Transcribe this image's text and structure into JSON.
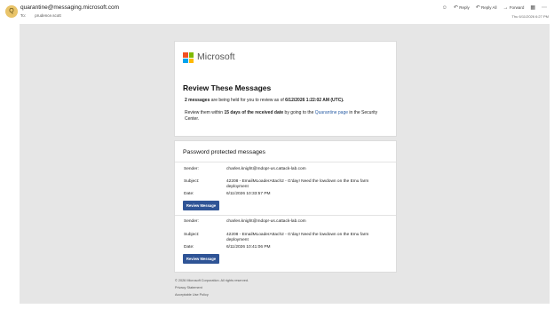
{
  "header": {
    "avatar_initial": "Q",
    "from": "quarantine@messaging.microsoft.com",
    "to_label": "To:",
    "to": "prudence.scott",
    "actions": [
      {
        "icon": "smiley-icon",
        "label": ""
      },
      {
        "icon": "reply-icon",
        "label": "Reply"
      },
      {
        "icon": "reply-all-icon",
        "label": "Reply All"
      },
      {
        "icon": "forward-icon",
        "label": "Forward"
      },
      {
        "icon": "apps-icon",
        "label": ""
      },
      {
        "icon": "more-icon",
        "label": ""
      }
    ],
    "date": "Thu 6/11/2026 6:27 PM"
  },
  "card1": {
    "brand": "Microsoft",
    "title": "Review These Messages",
    "p1_count": "2 messages",
    "p1_mid": " are being held for you to review as of ",
    "p1_date": "6/12/2026 1:22:02 AM (UTC).",
    "p2_start": "Review them within ",
    "p2_bold": "15 days of the received date",
    "p2_mid": " by going to the ",
    "p2_link": "Quarantine page",
    "p2_end": " in the Security Center."
  },
  "card2": {
    "title": "Password protected messages",
    "labels": {
      "sender": "Sender:",
      "subject": "Subject:",
      "date": "Date:"
    },
    "messages": [
      {
        "sender": "charles.knight@mdopr-us.cattack-lab.com",
        "subject": "42208 - EmailMLoaderAttach2 - G'day! Need the lowdown on the Emu farm deployment",
        "date": "6/11/2026 10:33:57 PM",
        "button": "Review Message"
      },
      {
        "sender": "charles.knight@mdopr-us.cattack-lab.com",
        "subject": "42208 - EmailMLoaderAttach2 - G'day! Need the lowdown on the Emu farm deployment",
        "date": "6/11/2026 10:41:06 PM",
        "button": "Review Message"
      }
    ]
  },
  "footer": {
    "copyright": "© 2026 Microsoft Corporation. All rights reserved.",
    "privacy": "Privacy Statement",
    "aup": "Acceptable Use Policy"
  },
  "colors": {
    "button": "#2f5496",
    "link": "#2b5fa6",
    "background": "#e6e6e6",
    "ms_red": "#f25022",
    "ms_green": "#7fba00",
    "ms_blue": "#00a4ef",
    "ms_yellow": "#ffb900"
  }
}
